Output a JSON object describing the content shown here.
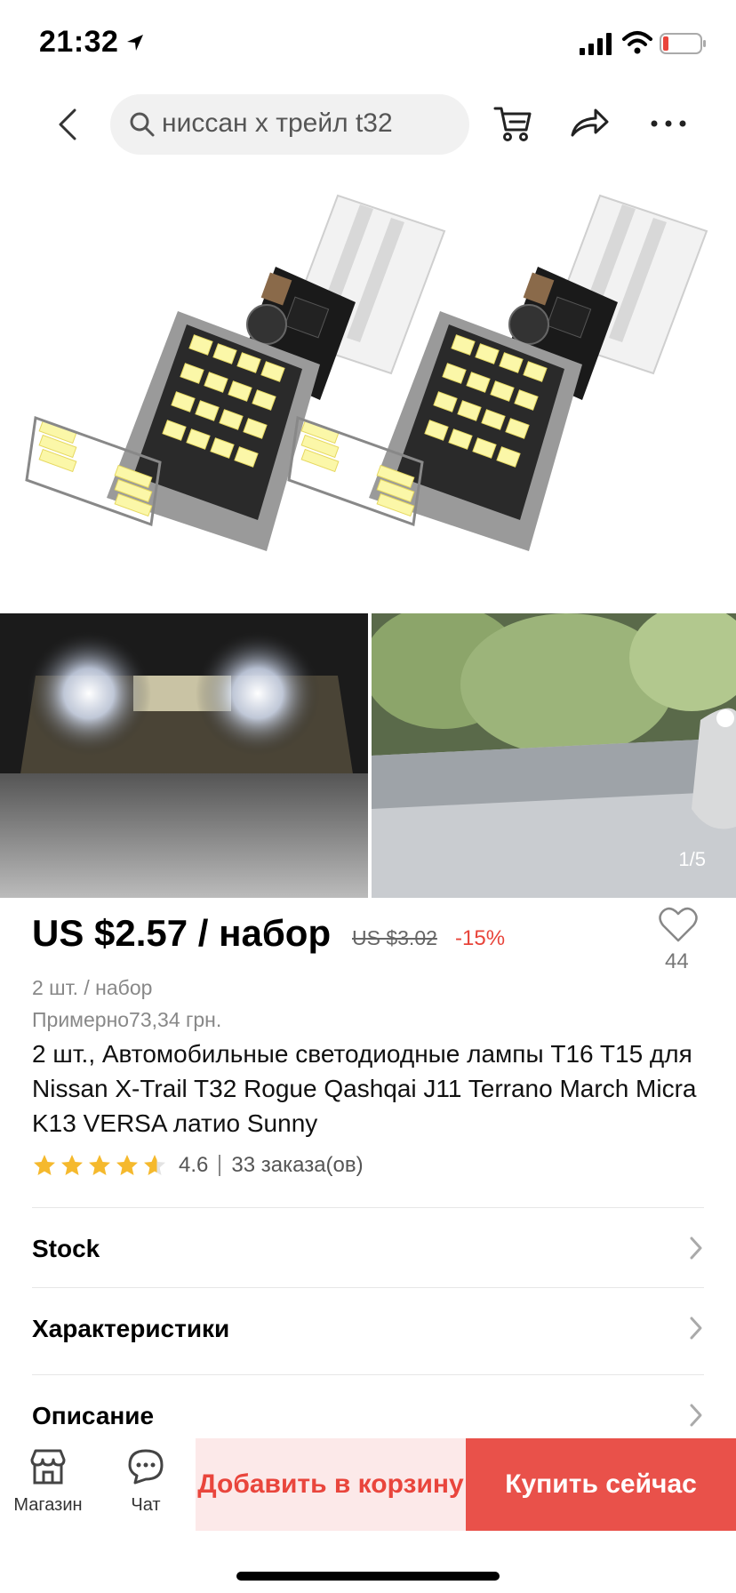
{
  "status": {
    "time": "21:32"
  },
  "nav": {
    "search_value": "ниссан х трейл t32"
  },
  "gallery": {
    "counter": "1/5"
  },
  "product": {
    "price": "US $2.57 / набор",
    "old_price": "US $3.02",
    "discount": "-15%",
    "wishlist_count": "44",
    "unit": "2 шт. / набор",
    "approx": "Примерно73,34 грн.",
    "title": "2 шт., Автомобильные светодиодные лампы T16 T15 для Nissan X-Trail T32 Rogue Qashqai J11 Terrano March Micra K13 VERSA латио Sunny",
    "rating_value": "4.6",
    "rating_stars": 4.6,
    "orders": "33 заказа(ов)"
  },
  "sections": [
    {
      "label": "Stock"
    },
    {
      "label": "Характеристики"
    },
    {
      "label": "Описание"
    }
  ],
  "bottom_bar": {
    "store_label": "Магазин",
    "chat_label": "Чат",
    "add_to_cart": "Добавить в корзину",
    "buy_now": "Купить сейчас"
  },
  "colors": {
    "accent": "#e9514a",
    "cart_bg": "#fce9e9",
    "discount": "#e8443a",
    "star": "#f5b92d"
  }
}
